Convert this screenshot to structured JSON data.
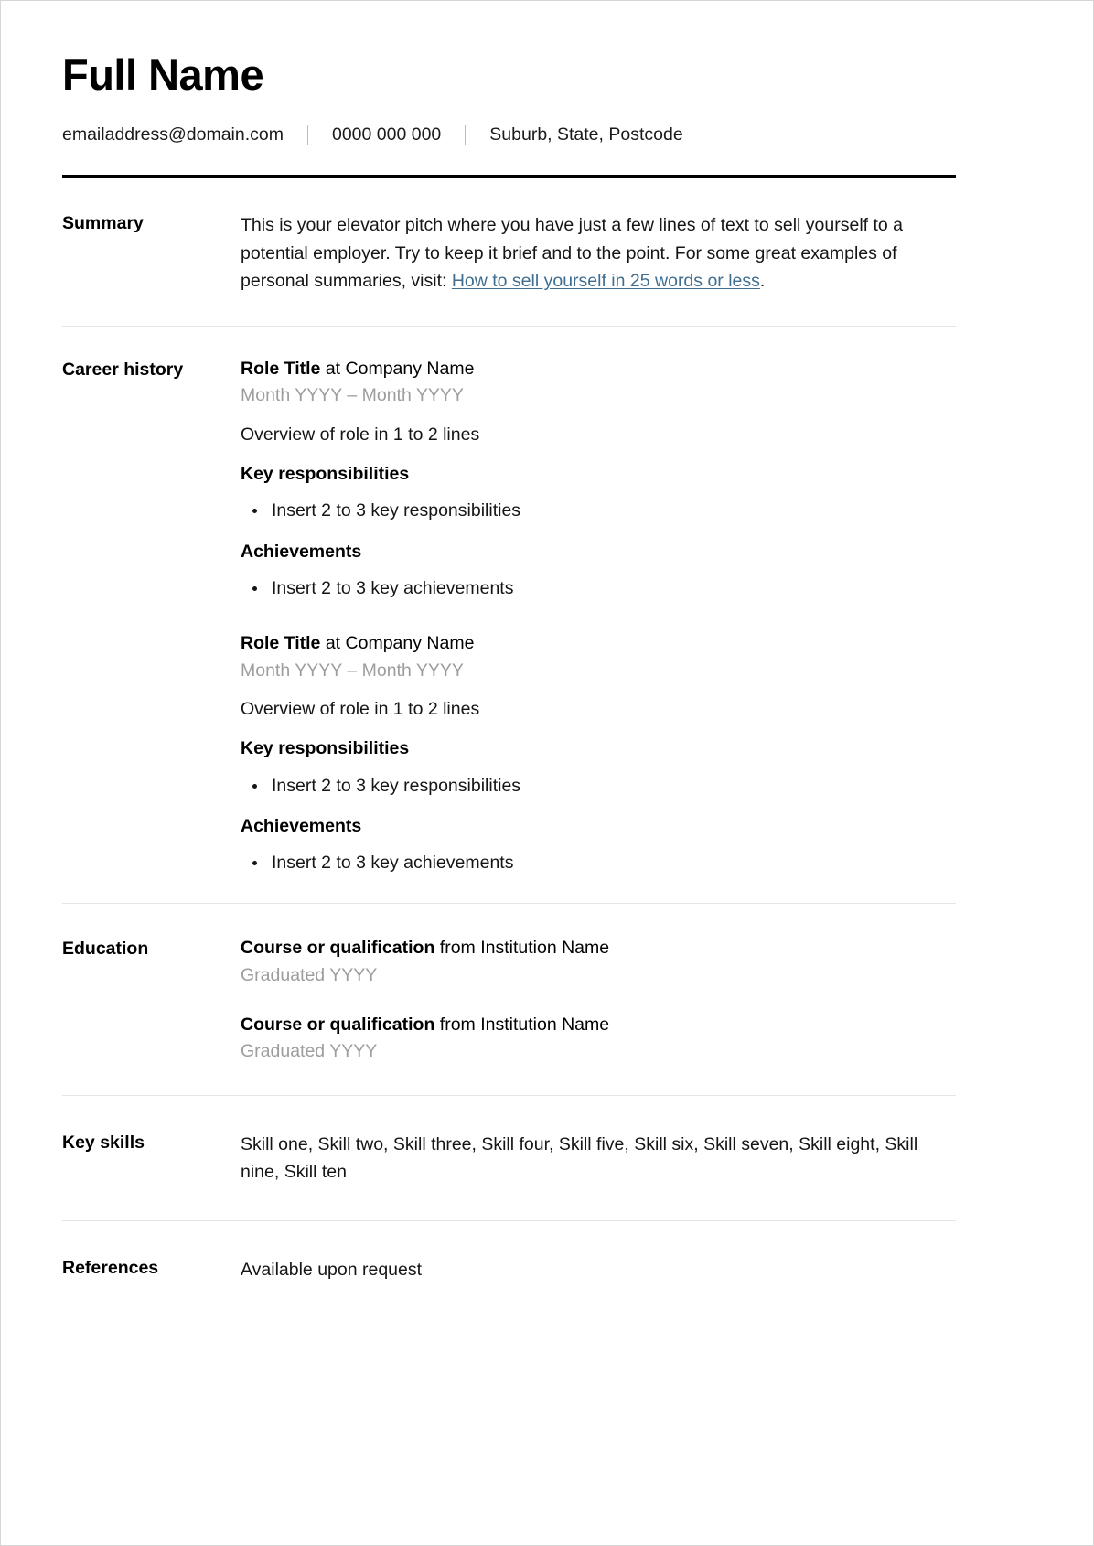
{
  "header": {
    "name": "Full Name",
    "email": "emailaddress@domain.com",
    "phone": "0000 000 000",
    "location": "Suburb, State, Postcode",
    "separator": "|"
  },
  "summary": {
    "label": "Summary",
    "text_before_link": "This is your elevator pitch where you have just a few lines of text to sell yourself to a potential employer. Try to keep it brief and to the point. For some great examples of personal summaries, visit: ",
    "link_text": "How to sell yourself in 25 words or less",
    "text_after_link": "."
  },
  "career": {
    "label": "Career history",
    "jobs": [
      {
        "role": "Role Title",
        "at_company": " at Company Name",
        "dates": "Month YYYY – Month YYYY",
        "overview": "Overview of role in 1 to 2 lines",
        "responsibilities_heading": "Key responsibilities",
        "responsibilities": [
          "Insert 2 to 3 key responsibilities"
        ],
        "achievements_heading": "Achievements",
        "achievements": [
          "Insert 2 to 3 key achievements"
        ]
      },
      {
        "role": "Role Title",
        "at_company": " at Company Name",
        "dates": "Month YYYY – Month YYYY",
        "overview": "Overview of role in 1 to 2 lines",
        "responsibilities_heading": "Key responsibilities",
        "responsibilities": [
          "Insert 2 to 3 key responsibilities"
        ],
        "achievements_heading": "Achievements",
        "achievements": [
          "Insert 2 to 3 key achievements"
        ]
      }
    ]
  },
  "education": {
    "label": "Education",
    "entries": [
      {
        "course": "Course or qualification",
        "from_institution": " from Institution Name",
        "graduated": "Graduated YYYY"
      },
      {
        "course": "Course or qualification",
        "from_institution": " from Institution Name",
        "graduated": "Graduated YYYY"
      }
    ]
  },
  "skills": {
    "label": "Key skills",
    "text": "Skill one, Skill two, Skill three, Skill four, Skill five, Skill six, Skill seven, Skill eight, Skill nine, Skill ten",
    "items": [
      "Skill one",
      "Skill two",
      "Skill three",
      "Skill four",
      "Skill five",
      "Skill six",
      "Skill seven",
      "Skill eight",
      "Skill nine",
      "Skill ten"
    ]
  },
  "references": {
    "label": "References",
    "text": "Available upon request"
  },
  "colors": {
    "text": "#151515",
    "muted": "#9d9d9d",
    "link": "#3f6e91",
    "rule_thick": "#000000",
    "rule_thin": "#e5e5e5",
    "page_border": "#d6d6d6"
  }
}
